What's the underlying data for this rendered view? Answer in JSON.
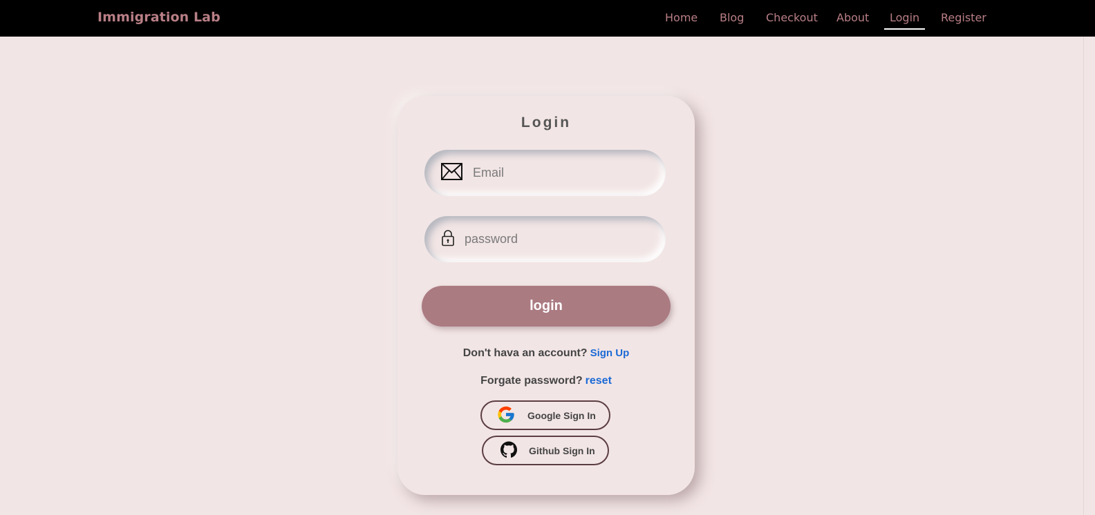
{
  "navbar": {
    "brand": "Immigration Lab",
    "links": [
      {
        "label": "Home"
      },
      {
        "label": "Blog"
      },
      {
        "label": "Checkout"
      },
      {
        "label": "About"
      },
      {
        "label": "Login",
        "active": true
      },
      {
        "label": "Register"
      }
    ]
  },
  "login": {
    "title": "Login",
    "email_placeholder": "Email",
    "password_placeholder": "password",
    "submit_label": "login",
    "signup_prompt": "Don't hava an account?",
    "signup_link": "Sign Up",
    "reset_prompt": "Forgate password?",
    "reset_link": "reset",
    "google_label": "Google Sign In",
    "github_label": "Github Sign In",
    "icons": {
      "email": "envelope-icon",
      "password": "lock-icon",
      "google": "google-icon",
      "github": "github-icon"
    }
  },
  "colors": {
    "background": "#f2e5e5",
    "navbar": "#000000",
    "accent": "#b97f86",
    "button": "#ab7b82",
    "link": "#1b6ad6"
  }
}
